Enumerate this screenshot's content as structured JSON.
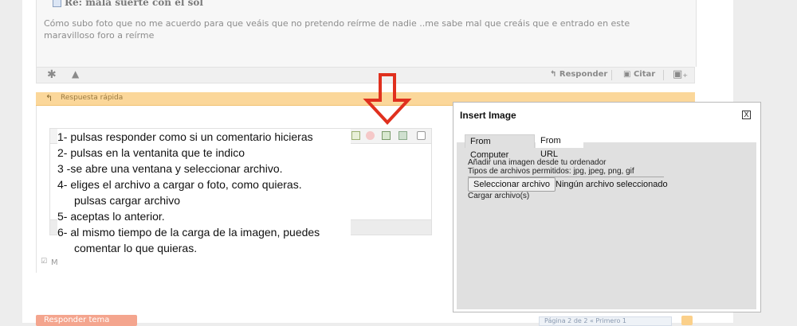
{
  "post": {
    "title": "Re: mala suerte con el sol",
    "body": "Cómo subo foto que no me acuerdo para que veáis que no pretendo reírme de nadie ..me sabe mal que creáis que e entrado en este maravilloso foro a reírme",
    "actions": {
      "reply_label": "Responder",
      "quote_label": "Citar"
    }
  },
  "quick_reply": {
    "header": "Respuesta rápida",
    "option_label": "M"
  },
  "instructions": [
    "1- pulsas responder como si un comentario hicieras",
    "2- pulsas en la ventanita que te indico",
    "3 -se abre una ventana y seleccionar archivo.",
    "4- eliges el archivo a cargar o foto, como quieras.",
    "pulsas cargar archivo",
    "5- aceptas lo anterior.",
    "6- al mismo tiempo de la carga de la imagen, puedes",
    "comentar lo que quieras."
  ],
  "modal": {
    "title": "Insert Image",
    "close_label": "X",
    "tabs": [
      {
        "label": "From Computer",
        "active": true
      },
      {
        "label": "From URL",
        "active": false
      }
    ],
    "add_text": "Añadir una imagen desde tu ordenador",
    "allowed_types": "Tipos de archivos permitidos: jpg, jpeg, png, gif",
    "select_file_label": "Seleccionar archivo",
    "no_file_text": "Ningún archivo seleccionado",
    "upload_label": "Cargar archivo(s)"
  },
  "footer": {
    "reply_button": "Responder tema",
    "pager_text": "Página 2 de 2 « Primero 1"
  },
  "colors": {
    "arrow": "#e0301e",
    "quick_reply_header": "#fbd79a"
  }
}
